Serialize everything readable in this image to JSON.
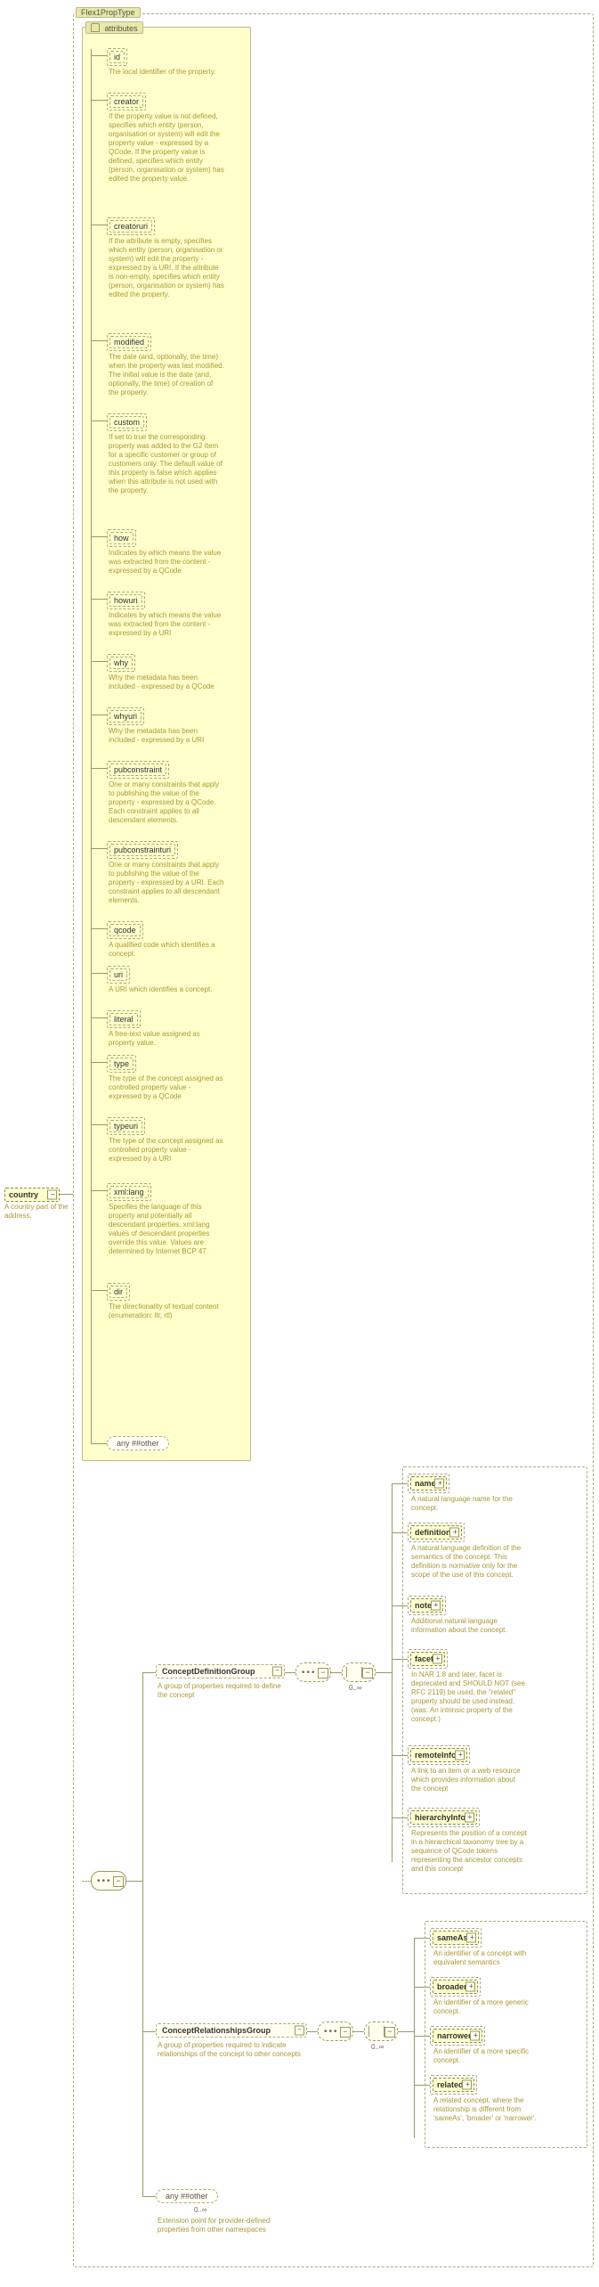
{
  "root": {
    "country": {
      "label": "country",
      "desc": "A country part of the address."
    },
    "flexType": "Flex1PropType",
    "attributesLabel": "attributes"
  },
  "attrs": [
    {
      "name": "id",
      "desc": "The local identifier of the property."
    },
    {
      "name": "creator",
      "desc": "If the property value is not defined, specifies which entity (person, organisation or system) will edit the property value - expressed by a QCode. If the property value is defined, specifies which entity (person, organisation or system) has edited the property value."
    },
    {
      "name": "creatoruri",
      "desc": "If the attribute is empty, specifies which entity (person, organisation or system) will edit the property - expressed by a URI. If the attribute is non-empty, specifies which entity (person, organisation or system) has edited the property."
    },
    {
      "name": "modified",
      "desc": "The date (and, optionally, the time) when the property was last modified. The initial value is the date (and, optionally, the time) of creation of the property."
    },
    {
      "name": "custom",
      "desc": "If set to true the corresponding property was added to the G2 Item for a specific customer or group of customers only. The default value of this property is false which applies when this attribute is not used with the property."
    },
    {
      "name": "how",
      "desc": "Indicates by which means the value was extracted from the content - expressed by a QCode"
    },
    {
      "name": "howuri",
      "desc": "Indicates by which means the value was extracted from the content - expressed by a URI"
    },
    {
      "name": "why",
      "desc": "Why the metadata has been included - expressed by a QCode"
    },
    {
      "name": "whyuri",
      "desc": "Why the metadata has been included - expressed by a URI"
    },
    {
      "name": "pubconstraint",
      "desc": "One or many constraints that apply to publishing the value of the property - expressed by a QCode. Each constraint applies to all descendant elements."
    },
    {
      "name": "pubconstrainturi",
      "desc": "One or many constraints that apply to publishing the value of the property - expressed by a URI. Each constraint applies to all descendant elements."
    },
    {
      "name": "qcode",
      "desc": "A qualified code which identifies a concept."
    },
    {
      "name": "uri",
      "desc": "A URI which identifies a concept."
    },
    {
      "name": "literal",
      "desc": "A free-text value assigned as property value."
    },
    {
      "name": "type",
      "desc": "The type of the concept assigned as controlled property value - expressed by a QCode"
    },
    {
      "name": "typeuri",
      "desc": "The type of the concept assigned as controlled property value - expressed by a URI"
    },
    {
      "name": "xml:lang",
      "desc": "Specifies the language of this property and potentially all descendant properties. xml:lang values of descendant properties override this value. Values are determined by Internet BCP 47."
    },
    {
      "name": "dir",
      "desc": "The directionality of textual content (enumeration: ltr, rtl)"
    }
  ],
  "attrWildcard": "any  ##other",
  "groups": {
    "def": {
      "name": "ConceptDefinitionGroup",
      "desc": "A group of properties required to define the concept"
    },
    "rel": {
      "name": "ConceptRelationshipsGroup",
      "desc": "A group of properties required to indicate relationships of the concept to other concepts"
    }
  },
  "children": {
    "def": [
      {
        "name": "name",
        "desc": "A natural language name for the concept."
      },
      {
        "name": "definition",
        "desc": "A natural language definition of the semantics of the concept. This definition is normative only for the scope of the use of this concept."
      },
      {
        "name": "note",
        "desc": "Additional natural language information about the concept."
      },
      {
        "name": "facet",
        "desc": "In NAR 1.8 and later, facet is deprecated and SHOULD NOT (see RFC 2119) be used, the \"related\" property should be used instead.(was: An intrinsic property of the concept.)"
      },
      {
        "name": "remoteInfo",
        "desc": "A link to an item or a web resource which provides information about the concept"
      },
      {
        "name": "hierarchyInfo",
        "desc": "Represents the position of a concept in a hierarchical taxonomy tree by a sequence of QCode tokens representing the ancestor concepts and this concept"
      }
    ],
    "rel": [
      {
        "name": "sameAs",
        "desc": "An identifier of a concept with equivalent semantics"
      },
      {
        "name": "broader",
        "desc": "An identifier of a more generic concept."
      },
      {
        "name": "narrower",
        "desc": "An identifier of a more specific concept."
      },
      {
        "name": "related",
        "desc": "A related concept, where the relationship is different from 'sameAs', 'broader' or 'narrower'."
      }
    ]
  },
  "extWildcard": {
    "label": "any  ##other",
    "occ": "0..∞",
    "desc": "Extension point for provider-defined properties from other namespaces"
  },
  "occ": "0..∞"
}
